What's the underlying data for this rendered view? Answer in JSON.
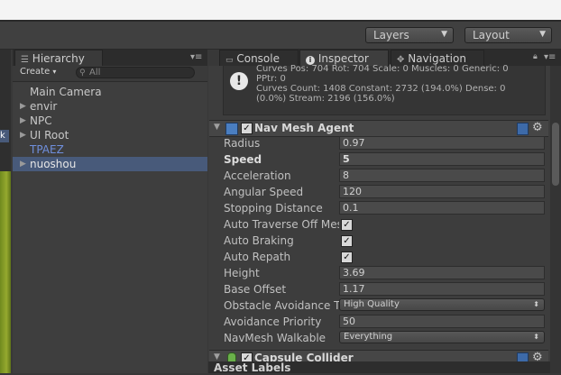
{
  "toolbar": {
    "layers_label": "Layers",
    "layout_label": "Layout"
  },
  "hierarchy": {
    "tab_label": "Hierarchy",
    "create_label": "Create",
    "search_placeholder": "All",
    "items": [
      {
        "label": "Main Camera",
        "has_children": false,
        "selected": false,
        "color": "default"
      },
      {
        "label": "envir",
        "has_children": true,
        "selected": false,
        "color": "default"
      },
      {
        "label": "NPC",
        "has_children": true,
        "selected": false,
        "color": "default"
      },
      {
        "label": "UI Root",
        "has_children": true,
        "selected": false,
        "color": "default"
      },
      {
        "label": "TPAEZ",
        "has_children": false,
        "selected": false,
        "color": "#6f8fdd"
      },
      {
        "label": "nuoshou",
        "has_children": true,
        "selected": true,
        "color": "default"
      }
    ]
  },
  "inspector": {
    "tabs": [
      {
        "label": "Console",
        "icon": "console-icon"
      },
      {
        "label": "Inspector",
        "icon": "info-icon",
        "active": true
      },
      {
        "label": "Navigation",
        "icon": "navigation-icon"
      }
    ],
    "notice_text": "Curves Pos: 704 Rot: 704 Scale: 0 Muscles: 0 Generic: 0\nPPtr: 0\nCurves Count: 1408 Constant: 2732 (194.0%) Dense: 0\n(0.0%) Stream: 2196 (156.0%)",
    "nav_mesh_agent": {
      "title": "Nav Mesh Agent",
      "enabled": true,
      "properties": [
        {
          "label": "Radius",
          "kind": "field",
          "value": "0.97",
          "bold": false
        },
        {
          "label": "Speed",
          "kind": "field",
          "value": "5",
          "bold": true
        },
        {
          "label": "Acceleration",
          "kind": "field",
          "value": "8",
          "bold": false
        },
        {
          "label": "Angular Speed",
          "kind": "field",
          "value": "120",
          "bold": false
        },
        {
          "label": "Stopping Distance",
          "kind": "field",
          "value": "0.1",
          "bold": false
        },
        {
          "label": "Auto Traverse Off Mesh Link",
          "kind": "check",
          "value": true
        },
        {
          "label": "Auto Braking",
          "kind": "check",
          "value": true
        },
        {
          "label": "Auto Repath",
          "kind": "check",
          "value": true
        },
        {
          "label": "Height",
          "kind": "field",
          "value": "3.69",
          "bold": false
        },
        {
          "label": "Base Offset",
          "kind": "field",
          "value": "1.17",
          "bold": false
        },
        {
          "label": "Obstacle Avoidance Type",
          "kind": "dropdown",
          "value": "High Quality"
        },
        {
          "label": "Avoidance Priority",
          "kind": "field",
          "value": "50",
          "bold": false
        },
        {
          "label": "NavMesh Walkable",
          "kind": "dropdown",
          "value": "Everything"
        }
      ]
    },
    "capsule_collider": {
      "title": "Capsule Collider",
      "enabled": true
    },
    "asset_labels": "Asset Labels"
  }
}
